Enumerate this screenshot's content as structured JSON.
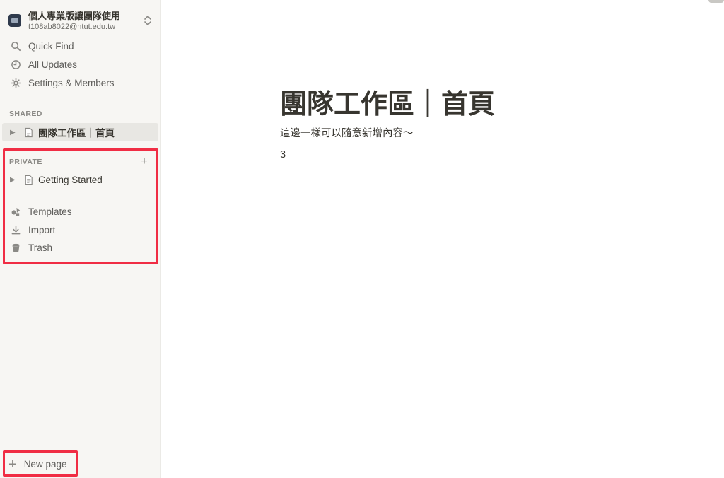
{
  "sidebar": {
    "workspace": {
      "name": "個人專業版讓團隊使用",
      "email": "t108ab8022@ntut.edu.tw"
    },
    "nav": [
      {
        "label": "Quick Find",
        "icon": "search-icon"
      },
      {
        "label": "All Updates",
        "icon": "clock-icon"
      },
      {
        "label": "Settings & Members",
        "icon": "gear-icon"
      }
    ],
    "shared": {
      "label": "SHARED",
      "pages": [
        {
          "label": "團隊工作區｜首頁"
        }
      ]
    },
    "private": {
      "label": "PRIVATE",
      "add": "+",
      "pages": [
        {
          "label": "Getting Started"
        }
      ]
    },
    "tools": [
      {
        "label": "Templates",
        "icon": "templates-icon"
      },
      {
        "label": "Import",
        "icon": "import-icon"
      },
      {
        "label": "Trash",
        "icon": "trash-icon"
      }
    ],
    "new_page": {
      "label": "New page",
      "icon": "plus-icon"
    }
  },
  "page": {
    "title": "團隊工作區｜首頁",
    "blocks": [
      "這邊一樣可以隨意新增內容～",
      "3"
    ]
  },
  "colors": {
    "sidebar_bg": "#f7f6f3",
    "highlight": "#f02d44",
    "text": "#37352f"
  }
}
